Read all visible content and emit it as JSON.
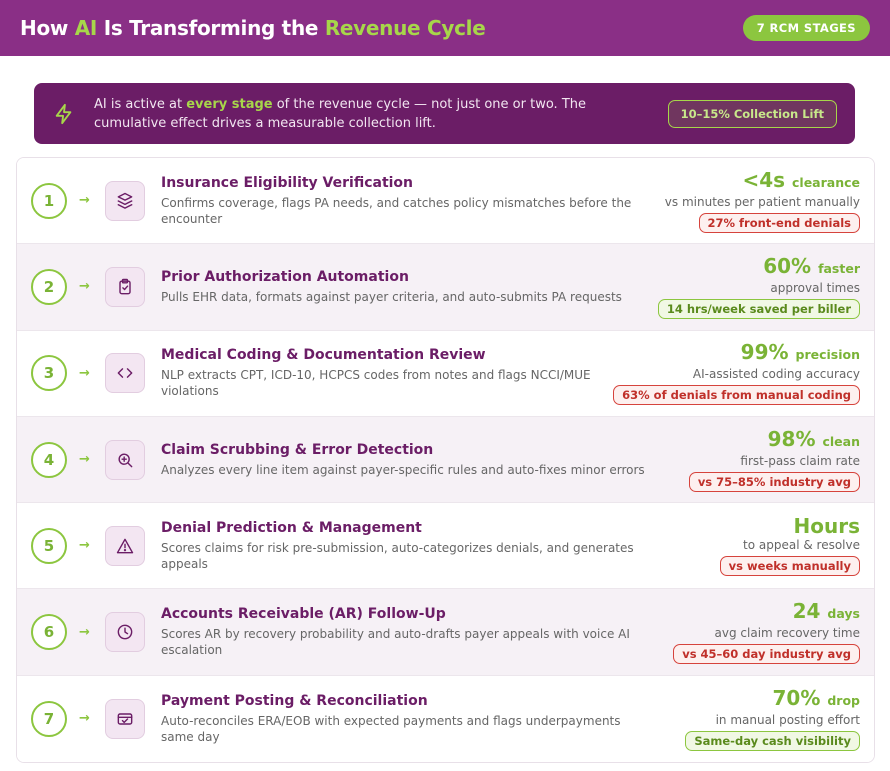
{
  "header": {
    "title_prefix": "How ",
    "title_ai": "AI",
    "title_mid": " Is Transforming the ",
    "title_accent": "Revenue Cycle",
    "badge": "7 RCM STAGES"
  },
  "callout": {
    "icon": "lightning-bolt-icon",
    "text_before": "AI is active at ",
    "text_highlight": "every stage",
    "text_after": " of the revenue cycle — not just one or two. The cumulative effect drives a measurable collection lift.",
    "pill": "10–15% Collection Lift"
  },
  "colors": {
    "brand": "#8a2f86",
    "dark_brand": "#6b1d66",
    "accent_green": "#8cc63f",
    "alert_red": "#d6433c"
  },
  "stages": [
    {
      "number": "1",
      "arrow": "→",
      "icon": "layers-icon",
      "title": "Insurance Eligibility Verification",
      "desc": "Confirms coverage, flags PA needs, and catches policy mismatches before the encounter",
      "metric_value": "<4s",
      "metric_unit": "clearance",
      "metric_sub": "vs minutes per patient manually",
      "tag": "27% front-end denials",
      "tag_type": "red"
    },
    {
      "number": "2",
      "arrow": "→",
      "icon": "clipboard-check-icon",
      "title": "Prior Authorization Automation",
      "desc": "Pulls EHR data, formats against payer criteria, and auto-submits PA requests",
      "metric_value": "60%",
      "metric_unit": "faster",
      "metric_sub": "approval times",
      "tag": "14 hrs/week saved per biller",
      "tag_type": "green"
    },
    {
      "number": "3",
      "arrow": "→",
      "icon": "code-brackets-icon",
      "title": "Medical Coding & Documentation Review",
      "desc": "NLP extracts CPT, ICD-10, HCPCS codes from notes and flags NCCI/MUE violations",
      "metric_value": "99%",
      "metric_unit": "precision",
      "metric_sub": "AI-assisted coding accuracy",
      "tag": "63% of denials from manual coding",
      "tag_type": "red"
    },
    {
      "number": "4",
      "arrow": "→",
      "icon": "zoom-in-icon",
      "title": "Claim Scrubbing & Error Detection",
      "desc": "Analyzes every line item against payer-specific rules and auto-fixes minor errors",
      "metric_value": "98%",
      "metric_unit": "clean",
      "metric_sub": "first-pass claim rate",
      "tag": "vs 75–85% industry avg",
      "tag_type": "red"
    },
    {
      "number": "5",
      "arrow": "→",
      "icon": "warning-triangle-icon",
      "title": "Denial Prediction & Management",
      "desc": "Scores claims for risk pre-submission, auto-categorizes denials, and generates appeals",
      "metric_value": "Hours",
      "metric_unit": "",
      "metric_sub": "to appeal & resolve",
      "tag": "vs weeks manually",
      "tag_type": "red"
    },
    {
      "number": "6",
      "arrow": "→",
      "icon": "clock-icon",
      "title": "Accounts Receivable (AR) Follow-Up",
      "desc": "Scores AR by recovery probability and auto-drafts payer appeals with voice AI escalation",
      "metric_value": "24",
      "metric_unit": "days",
      "metric_sub": "avg claim recovery time",
      "tag": "vs 45–60 day industry avg",
      "tag_type": "red"
    },
    {
      "number": "7",
      "arrow": "→",
      "icon": "payment-check-icon",
      "title": "Payment Posting & Reconciliation",
      "desc": "Auto-reconciles ERA/EOB with expected payments and flags underpayments same day",
      "metric_value": "70%",
      "metric_unit": "drop",
      "metric_sub": "in manual posting effort",
      "tag": "Same-day cash visibility",
      "tag_type": "green"
    }
  ]
}
